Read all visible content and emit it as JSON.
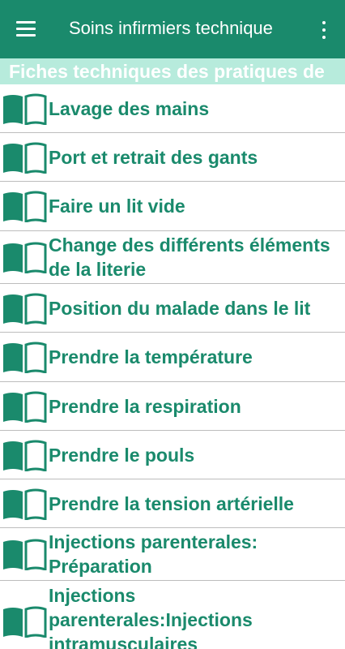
{
  "app": {
    "title": "Soins infirmiers technique",
    "menu_icon": "hamburger-menu-icon",
    "more_icon": "more-vert-icon",
    "colors": {
      "primary": "#1a8a6c",
      "banner": "#b7ebdc",
      "divider": "#bdbdbd"
    }
  },
  "banner": {
    "text": "Fiches techniques des pratiques de"
  },
  "list": {
    "item_icon": "open-book-icon",
    "items": [
      {
        "label": "Lavage des mains"
      },
      {
        "label": "Port et retrait des gants"
      },
      {
        "label": "Faire un lit vide"
      },
      {
        "label": "Change des différents éléments de la literie"
      },
      {
        "label": "Position du malade dans le lit"
      },
      {
        "label": "Prendre la température"
      },
      {
        "label": "Prendre la respiration"
      },
      {
        "label": "Prendre le pouls"
      },
      {
        "label": "Prendre la tension artérielle"
      },
      {
        "label": "Injections parenterales: Préparation"
      },
      {
        "label": "Injections parenterales:Injections intramusculaires"
      }
    ]
  }
}
